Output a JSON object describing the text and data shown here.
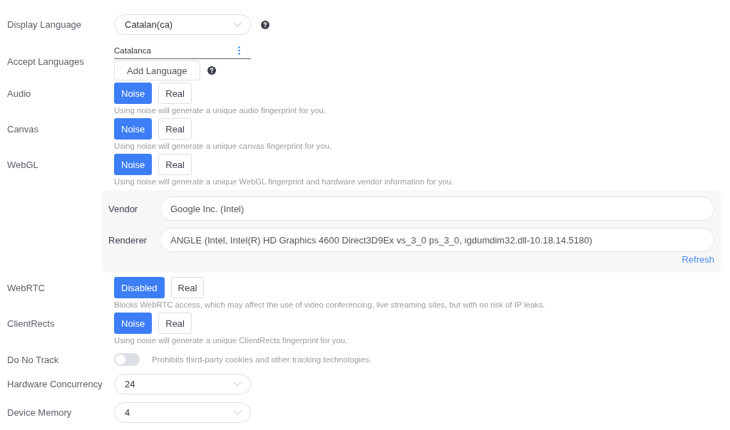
{
  "settings": [
    {
      "kind": "select",
      "label": "Display Language",
      "value": "Catalan(ca)",
      "help": true
    },
    {
      "kind": "languages",
      "label": "Accept Languages",
      "languages": [
        "Catalanca"
      ],
      "add_button": "Add Language",
      "help": true
    },
    {
      "kind": "segmented",
      "label": "Audio",
      "options": [
        {
          "label": "Noise",
          "selected": true
        },
        {
          "label": "Real",
          "selected": false
        }
      ],
      "hint": "Using noise will generate a unique audio fingerprint for you."
    },
    {
      "kind": "segmented",
      "label": "Canvas",
      "options": [
        {
          "label": "Noise",
          "selected": true
        },
        {
          "label": "Real",
          "selected": false
        }
      ],
      "hint": "Using noise will generate a unique canvas fingerprint for you."
    },
    {
      "kind": "segmented",
      "label": "WebGL",
      "options": [
        {
          "label": "Noise",
          "selected": true
        },
        {
          "label": "Real",
          "selected": false
        }
      ],
      "hint": "Using noise will generate a unique WebGL fingerprint and hardware vendor information for you.",
      "panel": {
        "fields": [
          {
            "label": "Vendor",
            "value": "Google Inc. (Intel)"
          },
          {
            "label": "Renderer",
            "value": "ANGLE (Intel, Intel(R) HD Graphics 4600 Direct3D9Ex vs_3_0 ps_3_0, igdumdim32.dll-10.18.14.5180)"
          }
        ],
        "refresh": "Refresh"
      }
    },
    {
      "kind": "segmented",
      "label": "WebRTC",
      "options": [
        {
          "label": "Disabled",
          "selected": true
        },
        {
          "label": "Real",
          "selected": false
        }
      ],
      "hint": "Blocks WebRTC access, which may affect the use of video conferencing, live streaming sites, but with no risk of IP leaks."
    },
    {
      "kind": "segmented",
      "label": "ClientRects",
      "options": [
        {
          "label": "Noise",
          "selected": true
        },
        {
          "label": "Real",
          "selected": false
        }
      ],
      "hint": "Using noise will generate a unique ClientRects fingerprint for you."
    },
    {
      "kind": "toggle",
      "label": "Do No Track",
      "on": false,
      "hint": "Prohibits third-party cookies and other tracking technologies."
    },
    {
      "kind": "select",
      "label": "Hardware Concurrency",
      "value": "24",
      "help": false
    },
    {
      "kind": "select",
      "label": "Device Memory",
      "value": "4",
      "help": false
    }
  ]
}
